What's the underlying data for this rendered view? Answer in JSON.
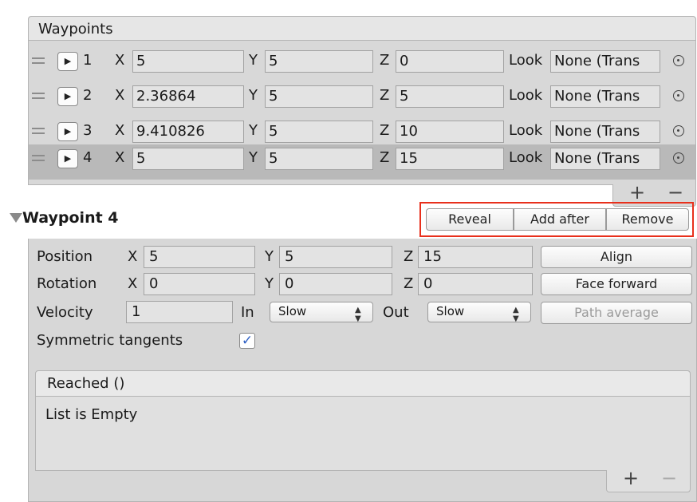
{
  "waypoints_list": {
    "title": "Waypoints",
    "rows": [
      {
        "index": "1",
        "x": "5",
        "y": "5",
        "z": "0",
        "look": "None (Trans"
      },
      {
        "index": "2",
        "x": "2.36864",
        "y": "5",
        "z": "5",
        "look": "None (Trans"
      },
      {
        "index": "3",
        "x": "9.410826",
        "y": "5",
        "z": "10",
        "look": "None (Trans"
      },
      {
        "index": "4",
        "x": "5",
        "y": "5",
        "z": "15",
        "look": "None (Trans"
      }
    ],
    "selected_index": 3,
    "labels": {
      "x": "X",
      "y": "Y",
      "z": "Z",
      "look": "Look"
    },
    "add_symbol": "+",
    "remove_symbol": "−"
  },
  "waypoint_detail": {
    "title": "Waypoint 4",
    "buttons": {
      "reveal": "Reveal",
      "add_after": "Add after",
      "remove": "Remove"
    },
    "position": {
      "label": "Position",
      "x": "5",
      "y": "5",
      "z": "15"
    },
    "rotation": {
      "label": "Rotation",
      "x": "0",
      "y": "0",
      "z": "0"
    },
    "velocity": {
      "label": "Velocity",
      "value": "1"
    },
    "in": {
      "label": "In",
      "value": "Slow"
    },
    "out": {
      "label": "Out",
      "value": "Slow"
    },
    "align_button": "Align",
    "face_forward_button": "Face forward",
    "path_average_button": "Path average",
    "symmetric_tangents": {
      "label": "Symmetric tangents",
      "checked": true
    },
    "axis_labels": {
      "x": "X",
      "y": "Y",
      "z": "Z"
    }
  },
  "event": {
    "title": "Reached ()",
    "empty_text": "List is Empty",
    "add_symbol": "+",
    "remove_symbol": "−"
  },
  "colors": {
    "highlight_frame": "#e8301c",
    "checkmark": "#2d5fc4",
    "selected_row": "#b9b9b9"
  },
  "icons": {
    "drag_handle": "drag-handle-icon",
    "foldout": "triangle-right-icon",
    "object_picker": "object-picker-icon",
    "collapse": "triangle-down-icon",
    "checkmark": "checkmark-icon",
    "select_arrows": "up-down-arrows-icon"
  }
}
